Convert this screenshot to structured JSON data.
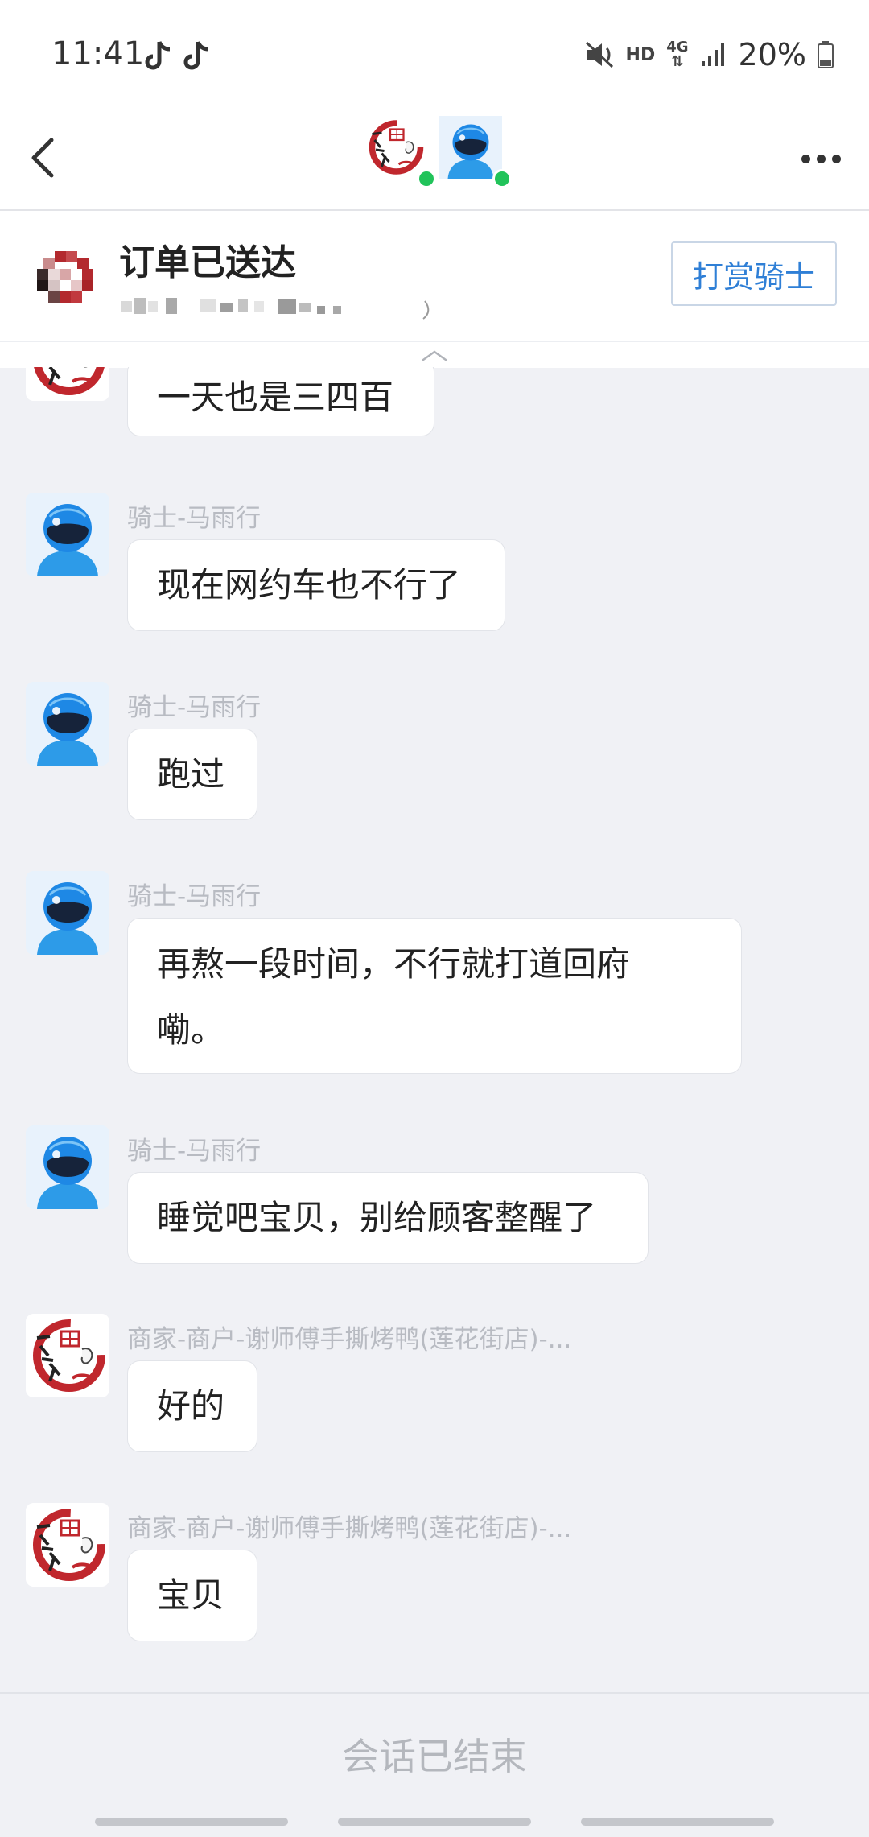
{
  "status_bar": {
    "time": "11:41",
    "hd_label": "HD",
    "network_label": "4G",
    "battery": "20%",
    "icons": [
      "tiktok-icon",
      "tiktok-icon",
      "mute-icon",
      "signal-icon",
      "battery-icon"
    ]
  },
  "header": {
    "back_icon": "chevron-left-icon",
    "more_icon": "more-horizontal-icon",
    "participants": [
      "merchant-avatar",
      "rider-avatar"
    ]
  },
  "order": {
    "title": "订单已送达",
    "tip_button_label": "打赏骑士"
  },
  "messages": [
    {
      "sender": "",
      "text": "一天也是三四百",
      "avatar": "merchant-avatar"
    },
    {
      "sender": "骑士-马雨行",
      "text": "现在网约车也不行了",
      "avatar": "rider-avatar"
    },
    {
      "sender": "骑士-马雨行",
      "text": "跑过",
      "avatar": "rider-avatar"
    },
    {
      "sender": "骑士-马雨行",
      "text_line1": "再熬一段时间，不行就打道回府",
      "text_line2": "嘞。",
      "avatar": "rider-avatar"
    },
    {
      "sender": "骑士-马雨行",
      "text": "睡觉吧宝贝，别给顾客整醒了",
      "avatar": "rider-avatar"
    },
    {
      "sender": "商家-商户-谢师傅手撕烤鸭(莲花街店)-...",
      "text": "好的",
      "avatar": "merchant-avatar"
    },
    {
      "sender": "商家-商户-谢师傅手撕烤鸭(莲花街店)-...",
      "text": "宝贝",
      "avatar": "merchant-avatar"
    }
  ],
  "footer": {
    "status_text": "会话已结束"
  },
  "colors": {
    "chat_background": "#f0f1f5",
    "tip_button_text": "#2f7fd6",
    "online_dot": "#21c35a",
    "rider_helmet": "#1e88e5",
    "merchant_red": "#c0272d"
  }
}
